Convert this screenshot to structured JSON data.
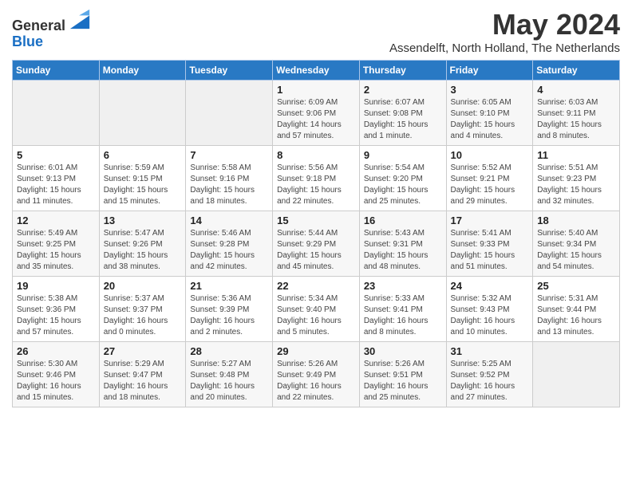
{
  "header": {
    "logo_line1": "General",
    "logo_line2": "Blue",
    "month_title": "May 2024",
    "subtitle": "Assendelft, North Holland, The Netherlands"
  },
  "days_of_week": [
    "Sunday",
    "Monday",
    "Tuesday",
    "Wednesday",
    "Thursday",
    "Friday",
    "Saturday"
  ],
  "weeks": [
    [
      {
        "day": "",
        "info": ""
      },
      {
        "day": "",
        "info": ""
      },
      {
        "day": "",
        "info": ""
      },
      {
        "day": "1",
        "info": "Sunrise: 6:09 AM\nSunset: 9:06 PM\nDaylight: 14 hours\nand 57 minutes."
      },
      {
        "day": "2",
        "info": "Sunrise: 6:07 AM\nSunset: 9:08 PM\nDaylight: 15 hours\nand 1 minute."
      },
      {
        "day": "3",
        "info": "Sunrise: 6:05 AM\nSunset: 9:10 PM\nDaylight: 15 hours\nand 4 minutes."
      },
      {
        "day": "4",
        "info": "Sunrise: 6:03 AM\nSunset: 9:11 PM\nDaylight: 15 hours\nand 8 minutes."
      }
    ],
    [
      {
        "day": "5",
        "info": "Sunrise: 6:01 AM\nSunset: 9:13 PM\nDaylight: 15 hours\nand 11 minutes."
      },
      {
        "day": "6",
        "info": "Sunrise: 5:59 AM\nSunset: 9:15 PM\nDaylight: 15 hours\nand 15 minutes."
      },
      {
        "day": "7",
        "info": "Sunrise: 5:58 AM\nSunset: 9:16 PM\nDaylight: 15 hours\nand 18 minutes."
      },
      {
        "day": "8",
        "info": "Sunrise: 5:56 AM\nSunset: 9:18 PM\nDaylight: 15 hours\nand 22 minutes."
      },
      {
        "day": "9",
        "info": "Sunrise: 5:54 AM\nSunset: 9:20 PM\nDaylight: 15 hours\nand 25 minutes."
      },
      {
        "day": "10",
        "info": "Sunrise: 5:52 AM\nSunset: 9:21 PM\nDaylight: 15 hours\nand 29 minutes."
      },
      {
        "day": "11",
        "info": "Sunrise: 5:51 AM\nSunset: 9:23 PM\nDaylight: 15 hours\nand 32 minutes."
      }
    ],
    [
      {
        "day": "12",
        "info": "Sunrise: 5:49 AM\nSunset: 9:25 PM\nDaylight: 15 hours\nand 35 minutes."
      },
      {
        "day": "13",
        "info": "Sunrise: 5:47 AM\nSunset: 9:26 PM\nDaylight: 15 hours\nand 38 minutes."
      },
      {
        "day": "14",
        "info": "Sunrise: 5:46 AM\nSunset: 9:28 PM\nDaylight: 15 hours\nand 42 minutes."
      },
      {
        "day": "15",
        "info": "Sunrise: 5:44 AM\nSunset: 9:29 PM\nDaylight: 15 hours\nand 45 minutes."
      },
      {
        "day": "16",
        "info": "Sunrise: 5:43 AM\nSunset: 9:31 PM\nDaylight: 15 hours\nand 48 minutes."
      },
      {
        "day": "17",
        "info": "Sunrise: 5:41 AM\nSunset: 9:33 PM\nDaylight: 15 hours\nand 51 minutes."
      },
      {
        "day": "18",
        "info": "Sunrise: 5:40 AM\nSunset: 9:34 PM\nDaylight: 15 hours\nand 54 minutes."
      }
    ],
    [
      {
        "day": "19",
        "info": "Sunrise: 5:38 AM\nSunset: 9:36 PM\nDaylight: 15 hours\nand 57 minutes."
      },
      {
        "day": "20",
        "info": "Sunrise: 5:37 AM\nSunset: 9:37 PM\nDaylight: 16 hours\nand 0 minutes."
      },
      {
        "day": "21",
        "info": "Sunrise: 5:36 AM\nSunset: 9:39 PM\nDaylight: 16 hours\nand 2 minutes."
      },
      {
        "day": "22",
        "info": "Sunrise: 5:34 AM\nSunset: 9:40 PM\nDaylight: 16 hours\nand 5 minutes."
      },
      {
        "day": "23",
        "info": "Sunrise: 5:33 AM\nSunset: 9:41 PM\nDaylight: 16 hours\nand 8 minutes."
      },
      {
        "day": "24",
        "info": "Sunrise: 5:32 AM\nSunset: 9:43 PM\nDaylight: 16 hours\nand 10 minutes."
      },
      {
        "day": "25",
        "info": "Sunrise: 5:31 AM\nSunset: 9:44 PM\nDaylight: 16 hours\nand 13 minutes."
      }
    ],
    [
      {
        "day": "26",
        "info": "Sunrise: 5:30 AM\nSunset: 9:46 PM\nDaylight: 16 hours\nand 15 minutes."
      },
      {
        "day": "27",
        "info": "Sunrise: 5:29 AM\nSunset: 9:47 PM\nDaylight: 16 hours\nand 18 minutes."
      },
      {
        "day": "28",
        "info": "Sunrise: 5:27 AM\nSunset: 9:48 PM\nDaylight: 16 hours\nand 20 minutes."
      },
      {
        "day": "29",
        "info": "Sunrise: 5:26 AM\nSunset: 9:49 PM\nDaylight: 16 hours\nand 22 minutes."
      },
      {
        "day": "30",
        "info": "Sunrise: 5:26 AM\nSunset: 9:51 PM\nDaylight: 16 hours\nand 25 minutes."
      },
      {
        "day": "31",
        "info": "Sunrise: 5:25 AM\nSunset: 9:52 PM\nDaylight: 16 hours\nand 27 minutes."
      },
      {
        "day": "",
        "info": ""
      }
    ]
  ]
}
